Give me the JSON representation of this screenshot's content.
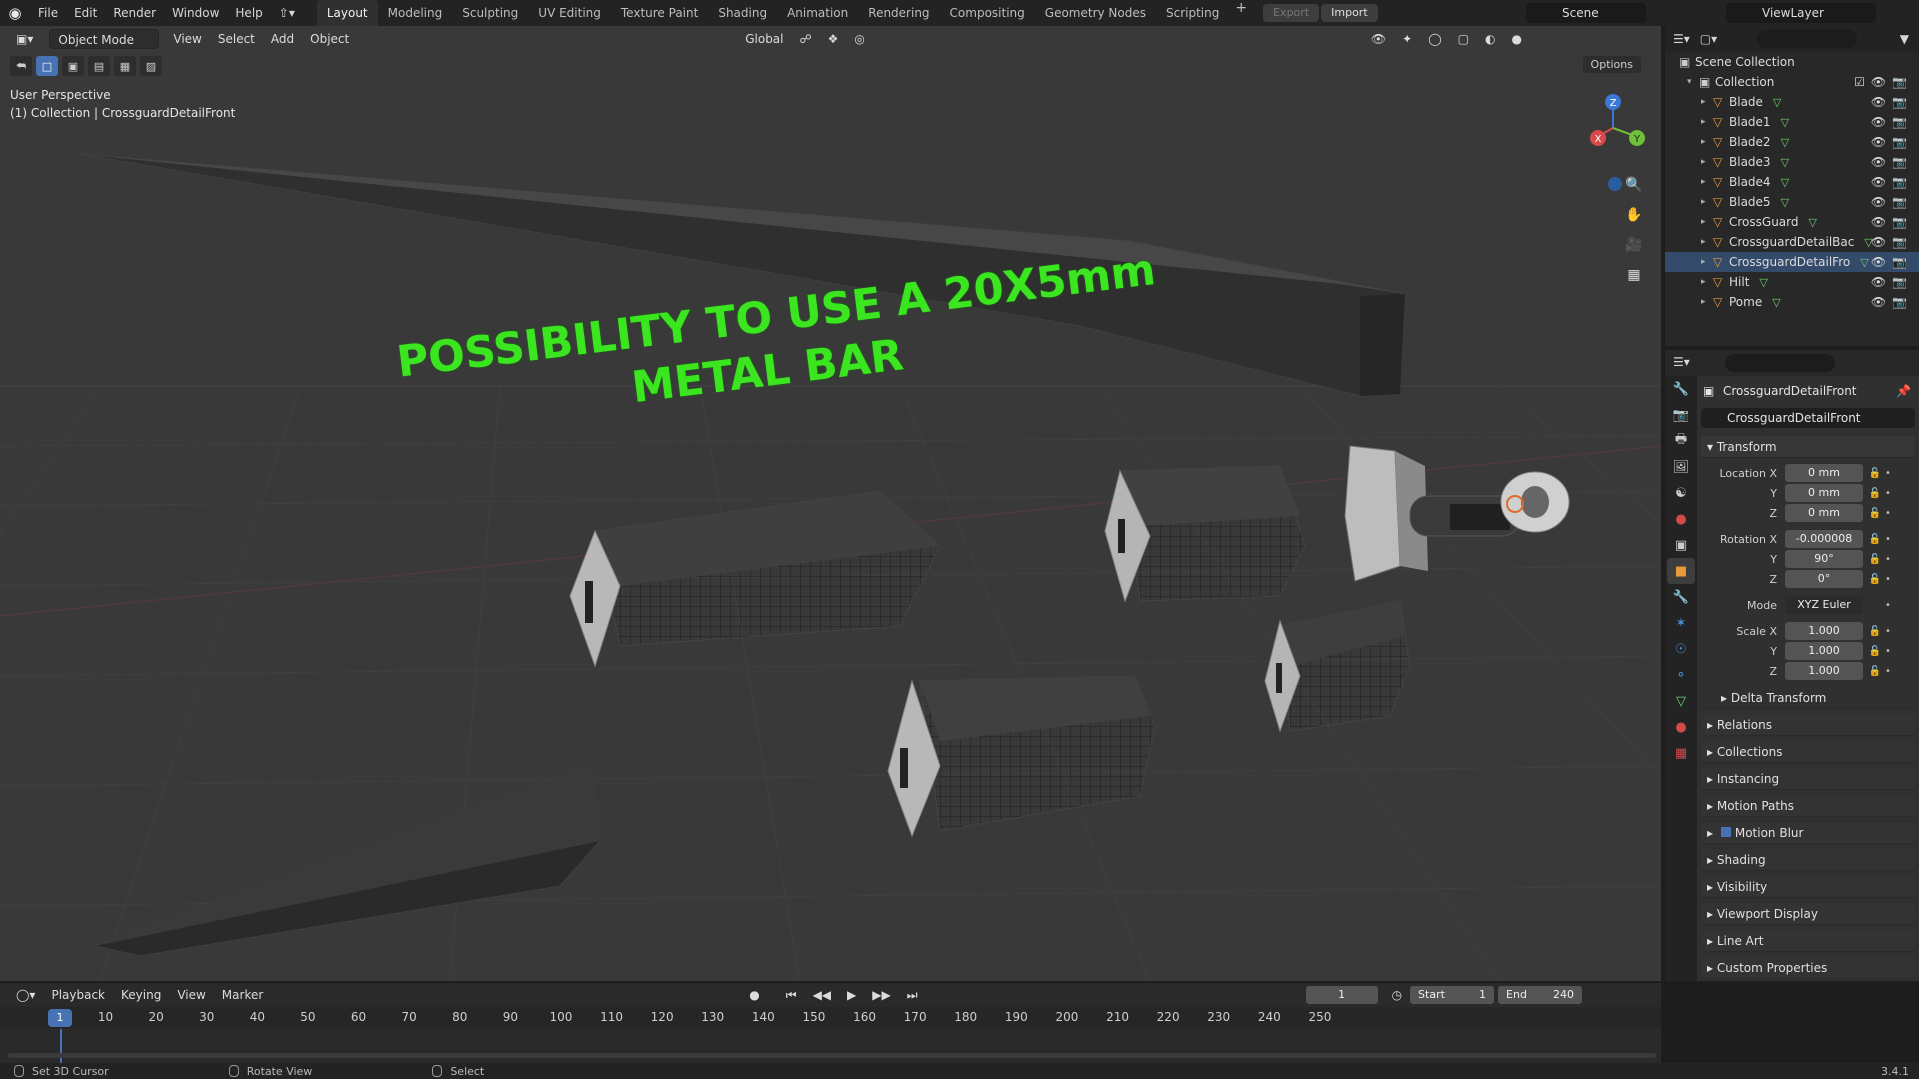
{
  "topbar": {
    "menus": [
      "File",
      "Edit",
      "Render",
      "Window",
      "Help"
    ],
    "workspaces": [
      "Layout",
      "Modeling",
      "Sculpting",
      "UV Editing",
      "Texture Paint",
      "Shading",
      "Animation",
      "Rendering",
      "Compositing",
      "Geometry Nodes",
      "Scripting"
    ],
    "active_workspace": "Layout",
    "export_label": "Export",
    "import_label": "Import",
    "scene": "Scene",
    "view_layer": "ViewLayer"
  },
  "viewport": {
    "mode": "Object Mode",
    "menus": [
      "View",
      "Select",
      "Add",
      "Object"
    ],
    "transform_orientation": "Global",
    "options_label": "Options",
    "perspective_label": "User Perspective",
    "context_label": "(1) Collection | CrossguardDetailFront",
    "annotation_line1": "POSSIBILITY TO USE A 20X5mm",
    "annotation_line2": "METAL  BAR",
    "gizmo": {
      "x": "X",
      "y": "Y",
      "z": "Z"
    }
  },
  "outliner": {
    "root": "Scene Collection",
    "collection": "Collection",
    "items": [
      {
        "name": "Blade"
      },
      {
        "name": "Blade1"
      },
      {
        "name": "Blade2"
      },
      {
        "name": "Blade3"
      },
      {
        "name": "Blade4"
      },
      {
        "name": "Blade5"
      },
      {
        "name": "CrossGuard"
      },
      {
        "name": "CrossguardDetailBac"
      },
      {
        "name": "CrossguardDetailFro"
      },
      {
        "name": "Hilt"
      },
      {
        "name": "Pome"
      }
    ]
  },
  "properties": {
    "object_name": "CrossguardDetailFront",
    "object_field": "CrossguardDetailFront",
    "transform_label": "Transform",
    "location": {
      "label": "Location X",
      "x": "0 mm",
      "y": "0 mm",
      "z": "0 mm"
    },
    "rotation": {
      "label": "Rotation X",
      "x": "-0.000008",
      "y": "90°",
      "z": "0°"
    },
    "mode_label": "Mode",
    "mode_value": "XYZ Euler",
    "scale": {
      "label": "Scale X",
      "x": "1.000",
      "y": "1.000",
      "z": "1.000"
    },
    "axis_y": "Y",
    "axis_z": "Z",
    "delta_transform": "Delta Transform",
    "sections": [
      "Relations",
      "Collections",
      "Instancing",
      "Motion Paths",
      "Motion Blur",
      "Shading",
      "Visibility",
      "Viewport Display",
      "Line Art",
      "Custom Properties"
    ]
  },
  "timeline": {
    "menus": [
      "Playback",
      "Keying",
      "View",
      "Marker"
    ],
    "current_frame": "1",
    "start_label": "Start",
    "start": "1",
    "end_label": "End",
    "end": "240",
    "ticks": [
      "1",
      "10",
      "20",
      "30",
      "40",
      "50",
      "60",
      "70",
      "80",
      "90",
      "100",
      "110",
      "120",
      "130",
      "140",
      "150",
      "160",
      "170",
      "180",
      "190",
      "200",
      "210",
      "220",
      "230",
      "240",
      "250"
    ]
  },
  "statusbar": {
    "hint1": "Set 3D Cursor",
    "hint2": "Rotate View",
    "hint3": "Select",
    "version": "3.4.1"
  },
  "colors": {
    "accent": "#4772b3",
    "annotation": "#3be51f",
    "object_icon": "#e99a3b",
    "mesh_icon": "#6bd46b"
  }
}
